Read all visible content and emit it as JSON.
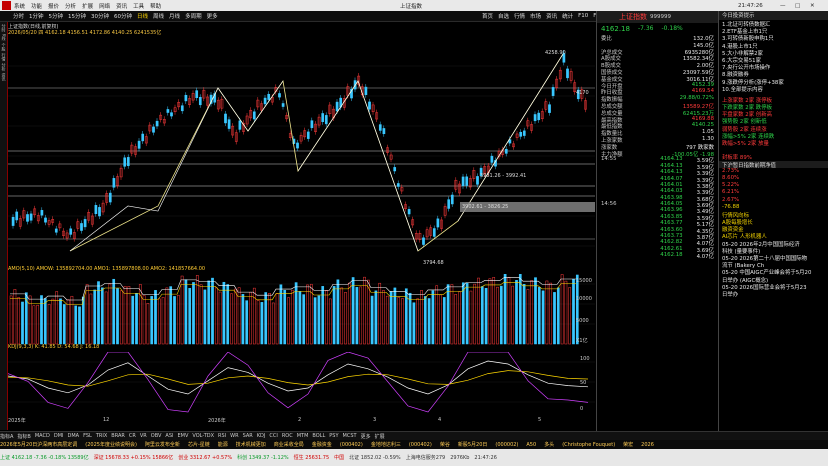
{
  "menubar": {
    "items": [
      "系统",
      "功能",
      "报价",
      "分析",
      "扩展",
      "网络",
      "资讯",
      "工具",
      "帮助"
    ],
    "center_title": "上证指数",
    "time": "21:47:26"
  },
  "toolbar": {
    "items": [
      "分时",
      "1分钟",
      "5分钟",
      "15分钟",
      "30分钟",
      "60分钟",
      "日线",
      "周线",
      "月线",
      "多周期",
      "更多"
    ],
    "active": "日线",
    "right": [
      "首页",
      "自选",
      "行情",
      "市场",
      "资讯",
      "统计",
      "F10",
      "F11"
    ]
  },
  "chart": {
    "main_title": "上证指数(日线,前复权)",
    "info_line": "2026/05/20 四  4162.18  4156.51  4172.86  4140.25  6241535亿",
    "price_labels": {
      "high": "4258.90",
      "low": "3794.68",
      "band1": "3981.26 - 3992.41",
      "band2": "3902.61 - 3826.25",
      "right_tick": "4170"
    },
    "vol_title": "AMO(5,10) AMOW: 135892704.00  AMO1: 135897808.00  AMO2: 141857664.00",
    "vol_ticks": [
      "15000",
      "10000",
      "5000",
      "X1亿"
    ],
    "kdj_title": "KDJ(9,3,3)  K: 41.85  D: 54.68  J: 16.18",
    "kdj_ticks": [
      "100",
      "50",
      "0"
    ],
    "x_labels": [
      "2025年",
      "12",
      "2026年",
      "2",
      "3",
      "4",
      "5"
    ],
    "indicator_tabs": [
      "指标A",
      "指标B",
      "MACD",
      "DMI",
      "DMA",
      "FSL",
      "TRIX",
      "BRAR",
      "CR",
      "VR",
      "OBV",
      "ASI",
      "EMV",
      "VOL-TDX",
      "RSI",
      "WR",
      "SAR",
      "KDJ",
      "CCI",
      "ROC",
      "MTM",
      "BOLL",
      "PSY",
      "MCST",
      "更多",
      "扩展"
    ]
  },
  "chart_data": {
    "type": "line",
    "series": [
      {
        "name": "AMO",
        "values": [
          11000,
          9800,
          10500,
          9600,
          12800,
          13400,
          12200,
          10800,
          12000,
          14200,
          13800,
          12900,
          11400,
          10700,
          12100,
          12600,
          11800,
          13200,
          14000,
          12400,
          11500,
          10800,
          11900,
          12600,
          13600,
          14100,
          14700,
          13900,
          13200,
          14400
        ]
      },
      {
        "name": "K",
        "values": [
          60,
          55,
          40,
          32,
          45,
          70,
          82,
          60,
          38,
          30,
          52,
          74,
          66,
          48,
          35,
          40,
          62,
          80,
          72,
          58,
          40,
          30,
          45,
          72,
          85,
          80,
          62,
          48,
          44,
          42
        ]
      },
      {
        "name": "D",
        "values": [
          58,
          57,
          52,
          45,
          43,
          52,
          62,
          63,
          55,
          46,
          48,
          57,
          60,
          56,
          49,
          45,
          50,
          59,
          63,
          62,
          55,
          47,
          46,
          53,
          64,
          69,
          67,
          61,
          56,
          55
        ]
      }
    ]
  },
  "rpanel": {
    "code": "999999",
    "name": "上证指数",
    "last": "4162.18",
    "change": "-7.36",
    "pct": "-0.18%",
    "rows": [
      {
        "k": "委比",
        "v": "132.0亿"
      },
      {
        "k": "",
        "v": "145.0亿"
      },
      {
        "k": "沪总成交",
        "v": "6935280亿"
      },
      {
        "k": "A股成交",
        "v": "13582.34亿"
      },
      {
        "k": "B股成交",
        "v": "2.00亿"
      },
      {
        "k": "国债成交",
        "v": "23097.59亿"
      },
      {
        "k": "基金成交",
        "v": "3016.11亿"
      },
      {
        "k": "今日开盘",
        "v": "4152.39"
      },
      {
        "k": "昨日收盘",
        "v": "4169.54"
      },
      {
        "k": "指数振幅",
        "v": "29.88/0.72%"
      },
      {
        "k": "总成交额",
        "v": "13589.27亿"
      },
      {
        "k": "总成交量",
        "v": "62415.23万"
      },
      {
        "k": "最高指数",
        "v": "4169.88"
      },
      {
        "k": "最低指数",
        "v": "4140.25"
      },
      {
        "k": "指数量比",
        "v": "1.05"
      },
      {
        "k": "上涨家数",
        "v": "1.30"
      },
      {
        "k": "涨家数",
        "v": "797  跌家数"
      },
      {
        "k": "主力净额",
        "v": "-100.05亿  -1.98"
      }
    ],
    "times": [
      "14:55",
      "14:56"
    ],
    "ticks": [
      "4164.13",
      "4164.13",
      "4164.13",
      "4164.07",
      "4164.01",
      "4164.03",
      "4163.98",
      "4164.05",
      "4163.96",
      "4163.85",
      "4163.77",
      "4163.60",
      "4163.73",
      "4162.82",
      "4162.61",
      "4162.18"
    ],
    "tick_vols": [
      "3.59亿",
      "3.59亿",
      "3.39亿",
      "3.39亿",
      "3.38亿",
      "3.39亿",
      "3.68亿",
      "3.69亿",
      "3.49亿",
      "3.59亿",
      "5.17亿",
      "4.35亿",
      "3.87亿",
      "4.07亿",
      "3.69亿",
      "4.07亿"
    ]
  },
  "farright": {
    "title": "今日投资提示",
    "items": [
      "1.北证可转债数据汇",
      "2.ETF基金上市1只",
      "3.可转债新股申购1只",
      "4.港股上市1只",
      "5.大小非解禁2家",
      "6.大宗交易51家",
      "7.央行公开市场操作",
      "8.融资融券",
      "9.涨跌停分析(涨停+38家",
      "10.全部提示内容"
    ],
    "stat_rows": [
      "上涨家数  2家  涨停板",
      "下跌家数  2家  跌停板",
      "平盘家数  2家  创新高",
      "强势股   2家  创新低",
      "弱势股   2家  连续涨",
      "涨幅>5%  2家  连续跌",
      "跌幅>5%  2家  放量",
      "",
      "封板率  89%"
    ],
    "sub_title": "下沪暂日指数前期净值",
    "sub_values": [
      "2.73%",
      "8.60%",
      "5.22%",
      "6.21%",
      "2.67%",
      "-76.88"
    ],
    "news": [
      "行情风向标",
      "A股每股增长",
      "融资资金",
      "AI芯片 人形机器人",
      "05-20 2026年2月中国国际经济",
      "科技 (量要事件)",
      "05-20 2026第二十八届中国国际物",
      "流节 (Bakery Ch",
      "05-20 中国AIGC产业峰会将于5月20",
      "日举办 (AIGC概念)",
      "05-20 2026国际营业会将于5月23",
      "日举办"
    ],
    "buttons": [
      "市场数据",
      "事件点播",
      "股东用户",
      "帮助"
    ]
  },
  "bottom1": {
    "items": [
      "2026年5月20日沪深两市高层定调",
      "(2025年度业绩说明会)",
      "阿里云发布全新",
      "芯片-星链",
      "能源",
      "技术机械更加",
      "商业采收全局",
      "金融资金",
      "(000402)",
      "金地地达利三",
      "(000402)",
      "荣谷",
      "新股5月20日",
      "(000002)",
      "A50",
      "多头",
      "(Christophe Fouquet)",
      "荣宏",
      "2026"
    ]
  },
  "bottom2": {
    "items": [
      "上证指数 4162.18 -7.36 -0.18%",
      "深证成指 15678.33 +24.1 +0.15%",
      "创业板指 3312.67 +18.88 +0.57%",
      "科创50 1349.37 -15.46 -1.12%",
      "上海指数 22431.75 +0.27%"
    ]
  },
  "statusbar": {
    "items": [
      "上证 4162.18 -7.36 -0.18% 13589亿",
      "深证 15678.33 +0.15% 15866亿",
      "创业 3312.67 +0.57%",
      "科创 1349.37 -1.12%",
      "恒生 25631.75",
      "中国",
      "北证 1852.02 -0.59%",
      "上海电信服务279",
      "2976Kb",
      "21:47:26"
    ]
  }
}
